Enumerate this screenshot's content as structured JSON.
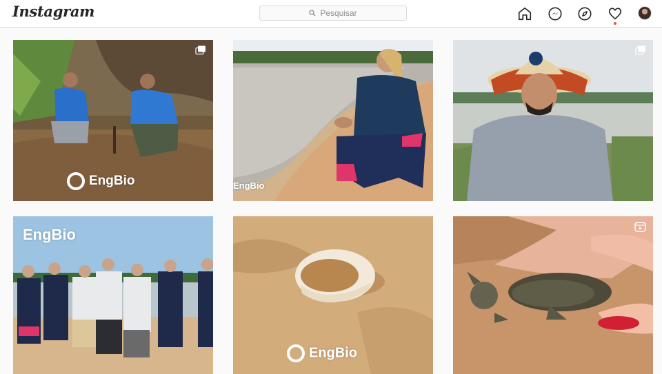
{
  "header": {
    "logo": "Instagram",
    "search_placeholder": "Pesquisar"
  },
  "nav_icons": [
    "home-icon",
    "messenger-icon",
    "explore-icon",
    "activity-heart-icon",
    "profile-avatar"
  ],
  "colors": {
    "border": "#dbdbdb",
    "background": "#fafafa",
    "notification": "#ed4956"
  },
  "grid": {
    "watermarks": {
      "post1": "EngBio",
      "post2": "EngBio",
      "post4": "EngBio",
      "post5": "EngBio"
    },
    "post_types": [
      "carousel",
      "photo",
      "carousel",
      "photo",
      "photo",
      "reel"
    ]
  }
}
